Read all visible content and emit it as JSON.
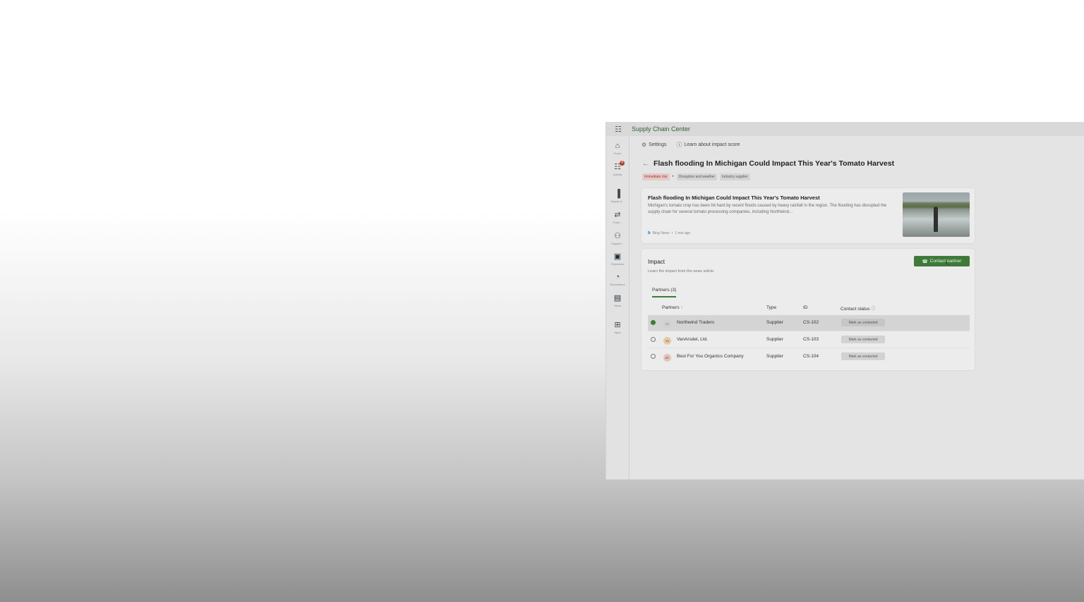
{
  "app": {
    "title": "Supply Chain Center"
  },
  "rail": {
    "items": [
      {
        "label": "Home",
        "icon": "home-icon"
      },
      {
        "label": "Activity",
        "icon": "activity-icon",
        "badge": "4"
      },
      {
        "label": "Supply &...",
        "icon": "supply-chart-icon"
      },
      {
        "label": "Order...",
        "icon": "orders-icon"
      },
      {
        "label": "Supplier...",
        "icon": "suppliers-icon"
      },
      {
        "label": "Shipments",
        "icon": "shipments-icon"
      },
      {
        "label": "Receiptions",
        "icon": "receiptions-icon"
      },
      {
        "label": "News",
        "icon": "news-icon"
      },
      {
        "label": "Apps",
        "icon": "apps-icon"
      }
    ]
  },
  "commandbar": {
    "settings_label": "Settings",
    "learn_label": "Learn about impact score"
  },
  "page": {
    "headline": "Flash flooding In Michigan Could Impact This Year's Tomato Harvest",
    "tags": [
      "Immediate risk",
      "Disruption and weather",
      "Industry supplier"
    ]
  },
  "article": {
    "title": "Flash flooding In Michigan Could Impact This Year's Tomato Harvest",
    "body": "Michigan's tomato crop has been hit hard by recent floods caused by heavy rainfall in the region. The flooding has disrupted the supply chain for several tomato processing companies, including Northwind...",
    "source": "Bing News",
    "time": "1 min ago"
  },
  "impact": {
    "title": "Impact",
    "subtitle": "Learn the impact from the news article.",
    "contact_button": "Contact partner",
    "tab_label": "Partners (3)",
    "columns": {
      "partners": "Partners",
      "type": "Type",
      "id": "ID",
      "contact_status": "Contact status"
    },
    "rows": [
      {
        "initials": "NT",
        "name": "Northwind Traders",
        "type": "Supplier",
        "id": "CS-102",
        "action": "Mark as contacted",
        "selected": true
      },
      {
        "initials": "VA",
        "name": "VanArsdel, Ltd.",
        "type": "Supplier",
        "id": "CS-103",
        "action": "Mark as contacted",
        "selected": false
      },
      {
        "initials": "BF",
        "name": "Best For You Organics Company",
        "type": "Supplier",
        "id": "CS-104",
        "action": "Mark as contacted",
        "selected": false
      }
    ]
  },
  "colors": {
    "accent": "#3f7a3b",
    "risk_tag": "#e8c9c4",
    "badge": "#b23a2c"
  }
}
